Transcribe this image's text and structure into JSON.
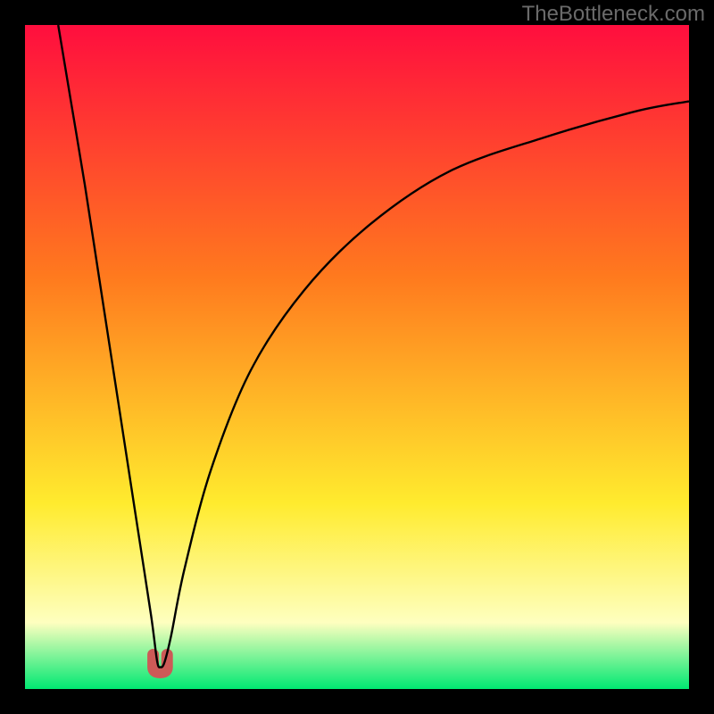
{
  "watermark": "TheBottleneck.com",
  "colors": {
    "gradient_top": "#ff0e3e",
    "gradient_mid_high": "#ff7a1e",
    "gradient_mid_low": "#ffeb2e",
    "gradient_pale": "#feffbf",
    "gradient_bottom": "#00e872",
    "curve": "#000000",
    "marker": "#cc5a57",
    "frame": "#000000"
  },
  "chart_data": {
    "type": "line",
    "title": "",
    "xlabel": "",
    "ylabel": "",
    "xlim": [
      0,
      100
    ],
    "ylim": [
      0,
      100
    ],
    "grid": false,
    "legend": false,
    "series": [
      {
        "name": "bottleneck-curve",
        "x": [
          5,
          7,
          9,
          11,
          13,
          15,
          17,
          19,
          19.9,
          20.4,
          21,
          22,
          24,
          28,
          34,
          42,
          52,
          64,
          78,
          92,
          100
        ],
        "y": [
          100,
          88,
          76,
          63,
          50,
          37,
          24,
          11,
          4.2,
          3.3,
          4.0,
          8,
          18,
          33,
          48,
          60,
          70,
          78,
          83,
          87,
          88.5
        ]
      }
    ],
    "minimum_marker": {
      "x_range": [
        19.3,
        21.4
      ],
      "y": 3.3,
      "shape": "u"
    }
  }
}
